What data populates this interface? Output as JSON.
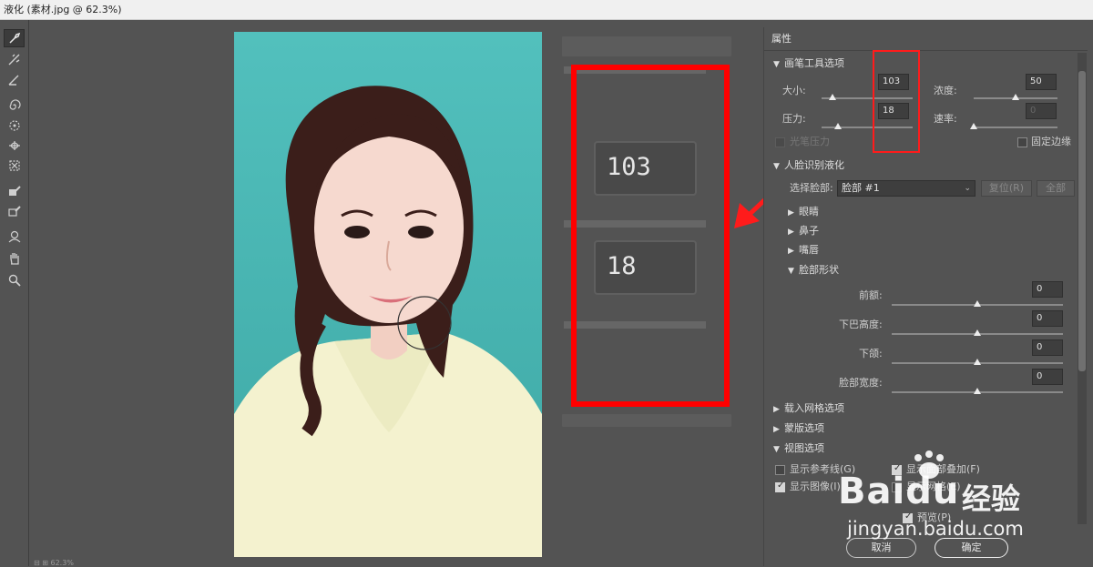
{
  "window": {
    "title": "液化 (素材.jpg @ 62.3%)"
  },
  "tools": [
    {
      "icon": "forward-warp-tool-icon"
    },
    {
      "icon": "reconstruct-tool-icon"
    },
    {
      "icon": "smooth-tool-icon"
    },
    {
      "icon": "twirl-clockwise-tool-icon"
    },
    {
      "icon": "pucker-tool-icon"
    },
    {
      "icon": "bloat-tool-icon"
    },
    {
      "icon": "push-left-tool-icon"
    },
    {
      "icon": "freeze-mask-tool-icon"
    },
    {
      "icon": "thaw-mask-tool-icon"
    },
    {
      "icon": "face-tool-icon"
    },
    {
      "icon": "hand-tool-icon"
    },
    {
      "icon": "zoom-tool-icon"
    }
  ],
  "zoom_callout": {
    "size_value": "103",
    "pressure_value": "18"
  },
  "panel": {
    "title": "属性",
    "brush": {
      "header": "画笔工具选项",
      "size_label": "大小:",
      "size_value": "103",
      "size_level": 0.12,
      "density_label": "浓度:",
      "density_value": "50",
      "density_level": 0.5,
      "pressure_label": "压力:",
      "pressure_value": "18",
      "pressure_level": 0.18,
      "rate_label": "速率:",
      "rate_value": "0",
      "rate_level": 0.0,
      "stylus_label": "光笔压力",
      "pin_edges_label": "固定边缘"
    },
    "face": {
      "header": "人脸识别液化",
      "select_face_label": "选择脸部:",
      "select_face_value": "脸部 #1",
      "reset_label": "复位(R)",
      "all_label": "全部",
      "groups": [
        "眼睛",
        "鼻子",
        "嘴唇"
      ],
      "shape_header": "脸部形状",
      "shape_sliders": [
        {
          "label": "前额:",
          "value": "0"
        },
        {
          "label": "下巴高度:",
          "value": "0"
        },
        {
          "label": "下颌:",
          "value": "0"
        },
        {
          "label": "脸部宽度:",
          "value": "0"
        }
      ]
    },
    "load_mesh": "载入网格选项",
    "mask_options": "蒙版选项",
    "view_options": {
      "header": "视图选项",
      "show_guides": "显示参考线(G)",
      "show_face_overlay": "显示面部叠加(F)",
      "show_image": "显示图像(I)",
      "show_mesh": "显示网格(E)",
      "preview": "预览(P)"
    },
    "cancel": "取消",
    "ok": "确定"
  },
  "status": {
    "zoom": "62.3%"
  },
  "watermark": {
    "brand": "Baidu",
    "brand_cn": "经验",
    "url": "jingyan.baidu.com"
  }
}
